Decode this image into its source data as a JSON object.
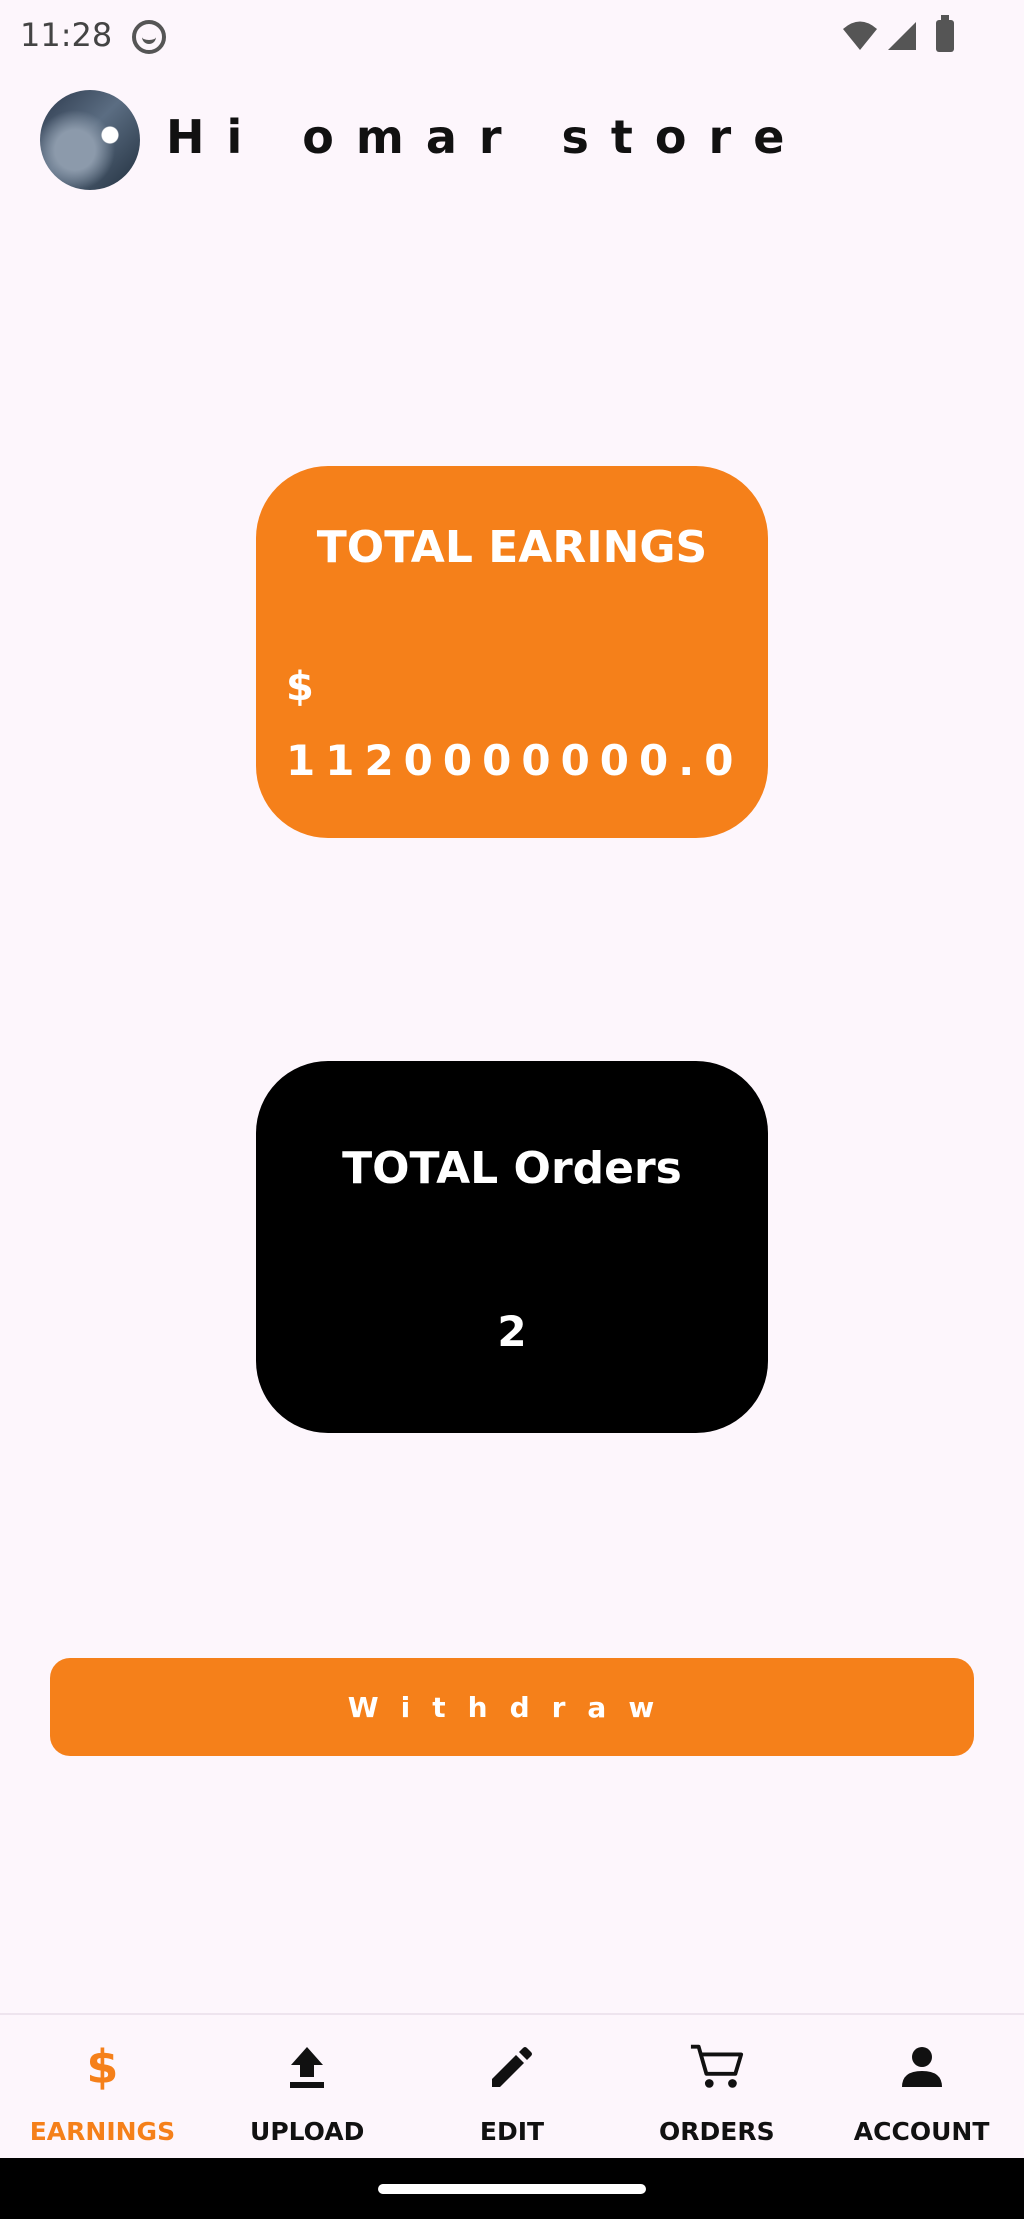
{
  "status_bar": {
    "time": "11:28"
  },
  "header": {
    "greeting": "Hi omar store"
  },
  "earnings_card": {
    "title": "TOTAL EARINGS",
    "currency": "$",
    "amount": "1120000000.0",
    "background": "#f5801a"
  },
  "orders_card": {
    "title": "TOTAL Orders",
    "count": "2",
    "background": "#000000"
  },
  "withdraw": {
    "label": "Withdraw"
  },
  "bottom_nav": {
    "active_color": "#f5801a",
    "items": [
      {
        "label": "EARNINGS",
        "icon": "dollar-icon",
        "active": true
      },
      {
        "label": "UPLOAD",
        "icon": "upload-icon",
        "active": false
      },
      {
        "label": "EDIT",
        "icon": "pencil-icon",
        "active": false
      },
      {
        "label": "ORDERS",
        "icon": "cart-icon",
        "active": false
      },
      {
        "label": "ACCOUNT",
        "icon": "person-icon",
        "active": false
      }
    ]
  }
}
